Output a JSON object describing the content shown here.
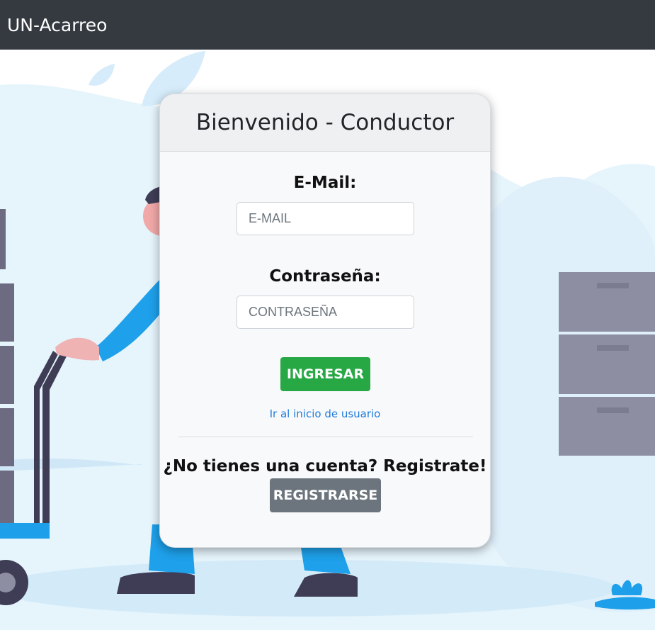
{
  "navbar": {
    "brand": "UN-Acarreo"
  },
  "login_card": {
    "title": "Bienvenido - Conductor",
    "email": {
      "label": "E-Mail:",
      "placeholder": "E-MAIL",
      "value": ""
    },
    "password": {
      "label": "Contraseña:",
      "placeholder": "CONTRASEÑA",
      "value": ""
    },
    "submit_label": "INGRESAR",
    "user_home_link": "Ir al inicio de usuario",
    "register_prompt": "¿No tienes una cuenta? Registrate!",
    "register_label": "REGISTRARSE"
  },
  "colors": {
    "navbar": "#343a40",
    "success": "#28a745",
    "secondary": "#6c757d",
    "link": "#1e7bdc",
    "card_bg": "#f8f9fa"
  },
  "background_illustration": "delivery-worker-with-hand-truck"
}
